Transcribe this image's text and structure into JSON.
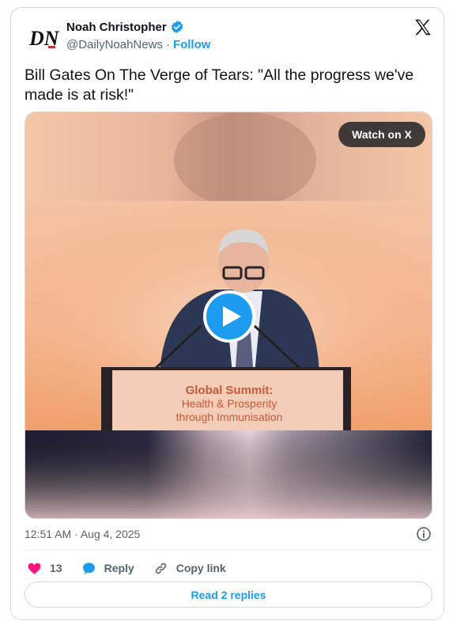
{
  "author": {
    "name": "Noah Christopher",
    "handle": "@DailyNoahNews",
    "separator": "·",
    "follow_label": "Follow",
    "avatar_text": "DN",
    "verified_color": "#1d9bf0"
  },
  "tweet": {
    "text": "Bill Gates On The Verge of Tears: \"All the progress we've made is at risk!\""
  },
  "media": {
    "watch_label": "Watch on X",
    "lectern_title": "Global Summit:",
    "lectern_line1": "Health & Prosperity",
    "lectern_line2": "through Immunisation"
  },
  "footer": {
    "timestamp": "12:51 AM · Aug 4, 2025"
  },
  "actions": {
    "like_count": "13",
    "reply_label": "Reply",
    "copy_label": "Copy link"
  },
  "read_replies_label": "Read 2 replies",
  "colors": {
    "accent": "#1d9bf0",
    "like": "#f91880",
    "text": "#0f1419",
    "muted": "#536471"
  }
}
